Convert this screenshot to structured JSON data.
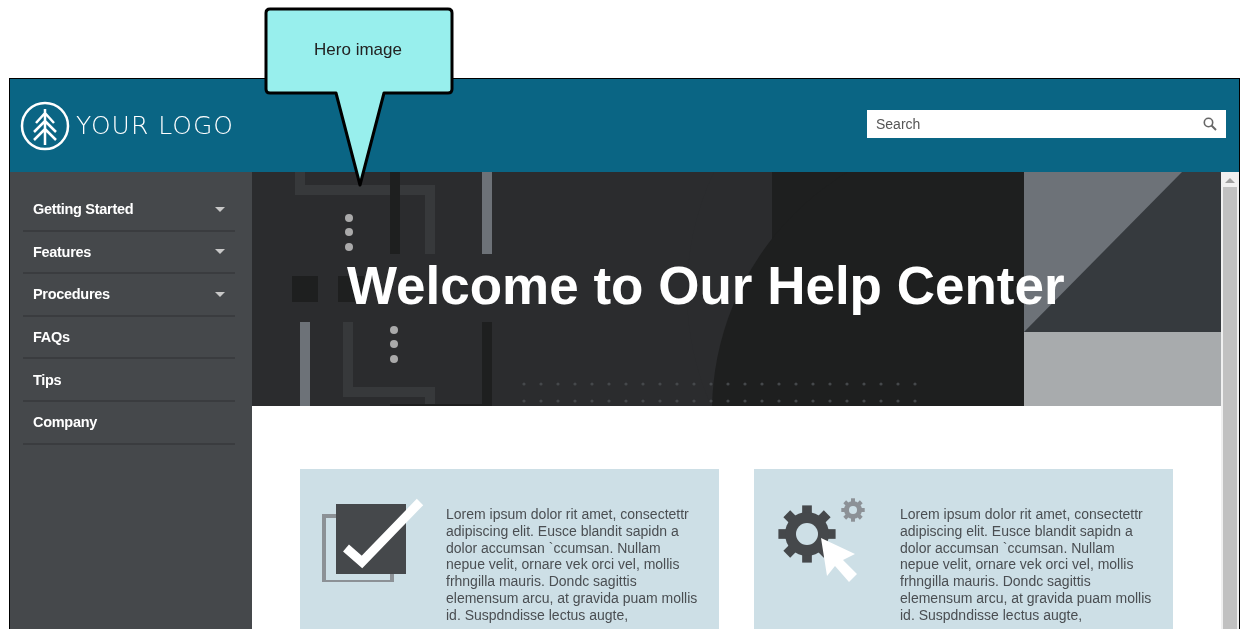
{
  "callout": {
    "label": "Hero image"
  },
  "header": {
    "logo_text": "YOUR LOGO",
    "search": {
      "placeholder": "Search"
    }
  },
  "sidebar": {
    "items": [
      {
        "label": "Getting Started",
        "expandable": true
      },
      {
        "label": "Features",
        "expandable": true
      },
      {
        "label": "Procedures",
        "expandable": true
      },
      {
        "label": "FAQs",
        "expandable": false
      },
      {
        "label": "Tips",
        "expandable": false
      },
      {
        "label": "Company",
        "expandable": false
      }
    ]
  },
  "hero": {
    "title": "Welcome to Our Help Center"
  },
  "cards": [
    {
      "kind": "checkbox",
      "text": "Lorem ipsum dolor rit amet, consectettr adipiscing elit. Eusce blandit sapidn a dolor accumsan `ccumsan. Nullam nepue velit, ornare vek orci vel, mollis frhngilla mauris. Dondc sagittis elemensum arcu, at gravida puam mollis id. Suspdndisse lectus augte,"
    },
    {
      "kind": "gears",
      "text": "Lorem ipsum dolor rit amet, consectettr adipiscing elit. Eusce blandit sapidn a dolor accumsan `ccumsan. Nullam nepue velit, ornare vek orci vel, mollis frhngilla mauris. Dondc sagittis elemensum arcu, at gravida puam mollis id. Suspdndisse lectus augte,"
    }
  ]
}
